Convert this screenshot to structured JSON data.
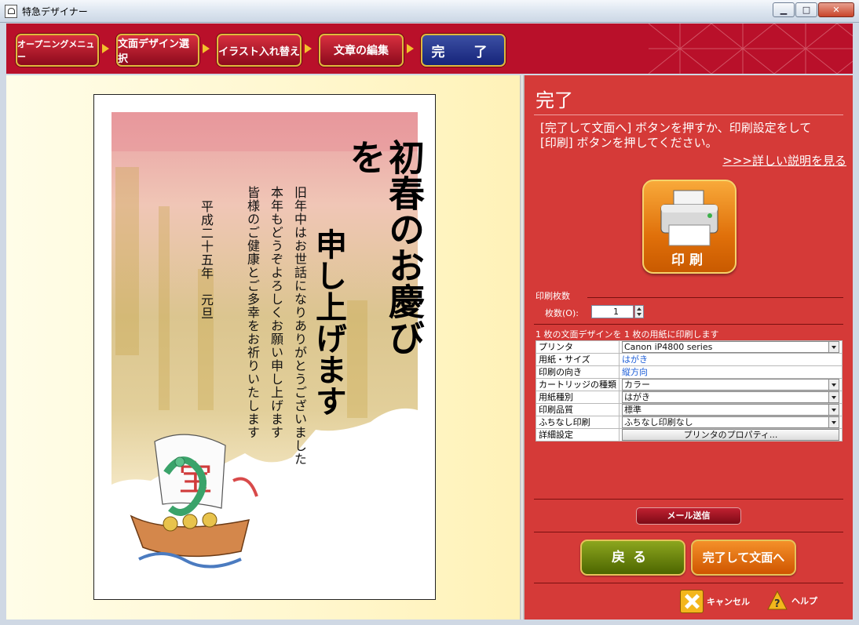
{
  "window": {
    "title": "特急デザイナー"
  },
  "steps": [
    {
      "label": "オープニングメニュー"
    },
    {
      "label": "文面デザイン選択"
    },
    {
      "label": "イラスト入れ替え"
    },
    {
      "label": "文章の編集"
    },
    {
      "label": "完　了"
    }
  ],
  "card": {
    "calligraphy_1": "初春のお慶びを",
    "calligraphy_2": "申し上げます",
    "line_1": "旧年中はお世話になりありがとうございました",
    "line_2": "本年もどうぞよろしくお願い申し上げます",
    "line_3": "皆様のご健康とご多幸をお祈りいたします",
    "date": "平成二十五年　元旦"
  },
  "panel": {
    "title": "完了",
    "instruction_1": "[完了して文面へ] ボタンを押すか、印刷設定をして",
    "instruction_2": "[印刷] ボタンを押してください。",
    "detail_link": ">>>詳しい説明を見る",
    "print_button": "印刷",
    "copies_section": "印刷枚数",
    "copies_label": "枚数(O):",
    "copies_value": "1",
    "summary": "1 枚の文面デザインを 1 枚の用紙に印刷します",
    "settings": [
      {
        "key": "プリンタ",
        "value": "Canon iP4800 series"
      },
      {
        "key": "用紙・サイズ",
        "value": "はがき"
      },
      {
        "key": "印刷の向き",
        "value": "縦方向"
      },
      {
        "key": "カートリッジの種類",
        "value": "カラー"
      },
      {
        "key": "用紙種別",
        "value": "はがき"
      },
      {
        "key": "印刷品質",
        "value": "標準"
      },
      {
        "key": "ふちなし印刷",
        "value": "ふちなし印刷なし"
      },
      {
        "key": "詳細設定",
        "value": "プリンタのプロパティ..."
      }
    ],
    "mail_button": "メール送信",
    "back_button": "戻る",
    "done_button": "完了して文面へ",
    "cancel_label": "キャンセル",
    "help_label": "ヘルプ"
  }
}
